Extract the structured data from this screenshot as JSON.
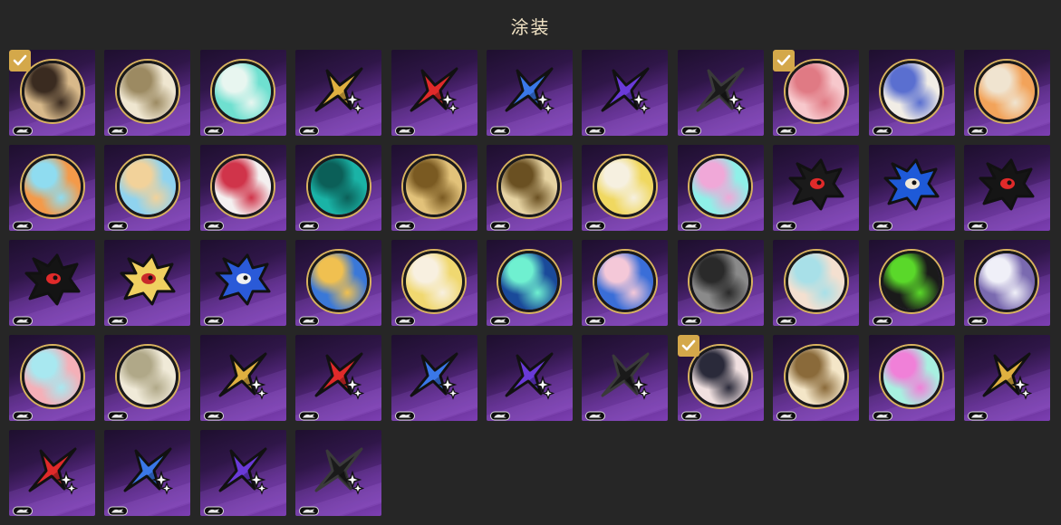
{
  "header": {
    "title": "涂装"
  },
  "items": [
    {
      "kind": "circle",
      "icon": "anime-character-brown-hair-icon",
      "c1": "#d8b98a",
      "c2": "#3a2b20",
      "selected": true
    },
    {
      "kind": "circle",
      "icon": "anime-character-white-hair-icon",
      "c1": "#efe6d0",
      "c2": "#9c8a62"
    },
    {
      "kind": "circle",
      "icon": "teal-sphere-icon",
      "c1": "#6fe0d0",
      "c2": "#e8f6f0"
    },
    {
      "kind": "star",
      "icon": "gold-star-sparkle-icon",
      "color": "#e0b040"
    },
    {
      "kind": "star",
      "icon": "red-star-sparkle-icon",
      "color": "#e02a2a"
    },
    {
      "kind": "star",
      "icon": "blue-star-sparkle-icon",
      "color": "#3a78e8"
    },
    {
      "kind": "star",
      "icon": "purple-star-sparkle-icon",
      "color": "#6a3ad8"
    },
    {
      "kind": "star",
      "icon": "black-star-sparkle-icon",
      "color": "#1a1a1a"
    },
    {
      "kind": "circle",
      "icon": "pink-anime-character-icon",
      "c1": "#f7c8cc",
      "c2": "#e07a84",
      "selected": true
    },
    {
      "kind": "circle",
      "icon": "blue-crest-emblem-icon",
      "c1": "#f1ede6",
      "c2": "#5a6fd0"
    },
    {
      "kind": "circle",
      "icon": "chibi-group-icon",
      "c1": "#f2a35a",
      "c2": "#f0e4d0"
    },
    {
      "kind": "circle",
      "icon": "cyan-crystal-icon",
      "c1": "#f39a4a",
      "c2": "#8fdcf0"
    },
    {
      "kind": "circle",
      "icon": "blonde-anime-character-icon",
      "c1": "#8fd3ef",
      "c2": "#f2d29a"
    },
    {
      "kind": "circle",
      "icon": "red-blue-brushstroke-icon",
      "c1": "#f4f0f0",
      "c2": "#d0344a"
    },
    {
      "kind": "circle",
      "icon": "teal-triangle-emblem-icon",
      "c1": "#1ab3a6",
      "c2": "#0b5f58"
    },
    {
      "kind": "circle",
      "icon": "gold-rocket-emblem-icon",
      "c1": "#e2c27a",
      "c2": "#7a5a22"
    },
    {
      "kind": "circle",
      "icon": "gold-arrow-emblem-icon",
      "c1": "#e6d3a2",
      "c2": "#6a5022"
    },
    {
      "kind": "circle",
      "icon": "yellow-anime-character-icon",
      "c1": "#f0d860",
      "c2": "#f6f0e0"
    },
    {
      "kind": "circle",
      "icon": "pastel-bubble-icon",
      "c1": "#8ff0e8",
      "c2": "#f0a8d8"
    },
    {
      "kind": "shape",
      "icon": "black-hedgehog-icon",
      "color": "#1a1a1a",
      "accent": "#e02a2a"
    },
    {
      "kind": "shape",
      "icon": "blue-hedgehog-icon",
      "color": "#1e5ad8",
      "accent": "#f0e8d8"
    },
    {
      "kind": "shape",
      "icon": "black-cat-mascot-icon",
      "color": "#151515",
      "accent": "#e02a2a"
    },
    {
      "kind": "shape",
      "icon": "dark-hero-silhouette-icon",
      "color": "#141414",
      "accent": "#e02a2a"
    },
    {
      "kind": "shape",
      "icon": "blonde-hero-profile-icon",
      "color": "#f0d060",
      "accent": "#c82a2a"
    },
    {
      "kind": "shape",
      "icon": "blue-hair-hero-profile-icon",
      "color": "#2a5ad8",
      "accent": "#f0f0f0"
    },
    {
      "kind": "circle",
      "icon": "penguin-emblem-icon",
      "c1": "#3a78d8",
      "c2": "#f0c050"
    },
    {
      "kind": "circle",
      "icon": "cartoon-cow-icon",
      "c1": "#f0d870",
      "c2": "#f8f0e0"
    },
    {
      "kind": "circle",
      "icon": "teal-building-icon",
      "c1": "#1a4a9a",
      "c2": "#6ff0d0"
    },
    {
      "kind": "circle",
      "icon": "pink-hair-chibi-icon",
      "c1": "#3a6ed8",
      "c2": "#f4c8d8"
    },
    {
      "kind": "circle",
      "icon": "dark-monolith-icon",
      "c1": "#8a8a8a",
      "c2": "#2a2a2a"
    },
    {
      "kind": "circle",
      "icon": "pale-blue-creature-icon",
      "c1": "#f4e0d0",
      "c2": "#a8e0e8"
    },
    {
      "kind": "circle",
      "icon": "green-splatter-icon",
      "c1": "#1a1a1a",
      "c2": "#5ad82a"
    },
    {
      "kind": "circle",
      "icon": "purple-crest-emblem-icon",
      "c1": "#7a6ab0",
      "c2": "#f0f0f8"
    },
    {
      "kind": "circle",
      "icon": "pastel-creature-icon",
      "c1": "#f4b0b8",
      "c2": "#a8e8f0"
    },
    {
      "kind": "circle",
      "icon": "white-cube-creature-icon",
      "c1": "#f0ead8",
      "c2": "#b0a888"
    },
    {
      "kind": "star",
      "icon": "gold-star-sparkle-icon",
      "color": "#e0b040"
    },
    {
      "kind": "star",
      "icon": "red-star-sparkle-icon",
      "color": "#e02a2a"
    },
    {
      "kind": "star",
      "icon": "blue-star-sparkle-icon",
      "color": "#3a78e8"
    },
    {
      "kind": "star",
      "icon": "purple-star-sparkle-icon",
      "color": "#6a3ad8"
    },
    {
      "kind": "star",
      "icon": "black-star-sparkle-icon",
      "color": "#1a1a1a"
    },
    {
      "kind": "circle",
      "icon": "dark-hair-duo-icon",
      "c1": "#f0e0e0",
      "c2": "#2a2a3a",
      "selected": true
    },
    {
      "kind": "circle",
      "icon": "white-hair-chibi-icon",
      "c1": "#f4e6c8",
      "c2": "#8a6a3a"
    },
    {
      "kind": "circle",
      "icon": "pink-cat-icon",
      "c1": "#a8f0e0",
      "c2": "#f080d8"
    },
    {
      "kind": "star",
      "icon": "gold-star-sparkle-icon",
      "color": "#e0b040"
    },
    {
      "kind": "star",
      "icon": "red-star-sparkle-icon",
      "color": "#e02a2a"
    },
    {
      "kind": "star",
      "icon": "blue-star-sparkle-icon",
      "color": "#3a78e8"
    },
    {
      "kind": "star",
      "icon": "purple-star-sparkle-icon",
      "color": "#6a3ad8"
    },
    {
      "kind": "star",
      "icon": "black-star-sparkle-icon",
      "color": "#1a1a1a"
    }
  ]
}
